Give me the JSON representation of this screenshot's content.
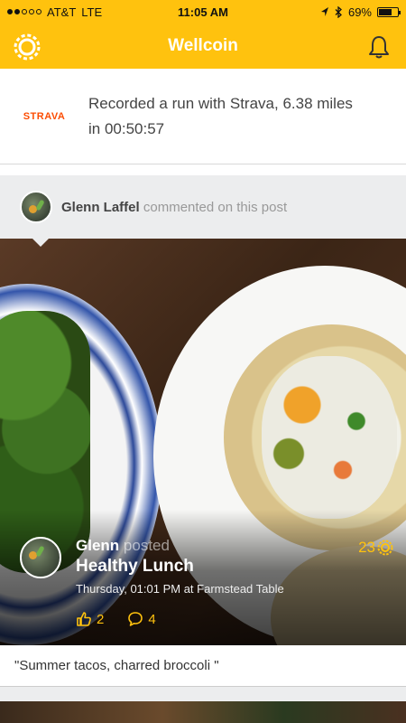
{
  "status_bar": {
    "carrier": "AT&T",
    "network": "LTE",
    "time": "11:05 AM",
    "battery": "69%",
    "battery_level": 0.69,
    "signal_bars": 2,
    "icons": [
      "location-arrow-icon",
      "bluetooth-icon",
      "battery-icon"
    ]
  },
  "header": {
    "title": "Wellcoin",
    "left_icon": "coin-settings-icon",
    "right_icon": "bell-icon",
    "accent_color": "#FFC20E"
  },
  "activity": {
    "logo": "STRAVA",
    "logo_color": "#FC4C02",
    "text": "Recorded a run with Strava, 6.38 miles in 00:50:57"
  },
  "comment_bar": {
    "commenter": "Glenn Laffel",
    "action": "commented on this post"
  },
  "post": {
    "poster": "Glenn",
    "posted_word": "posted",
    "title": "Healthy Lunch",
    "meta": "Thursday, 01:01 PM at Farmstead Table",
    "coins": "23",
    "likes": "2",
    "comments": "4",
    "caption": "\"Summer tacos, charred broccoli \""
  }
}
